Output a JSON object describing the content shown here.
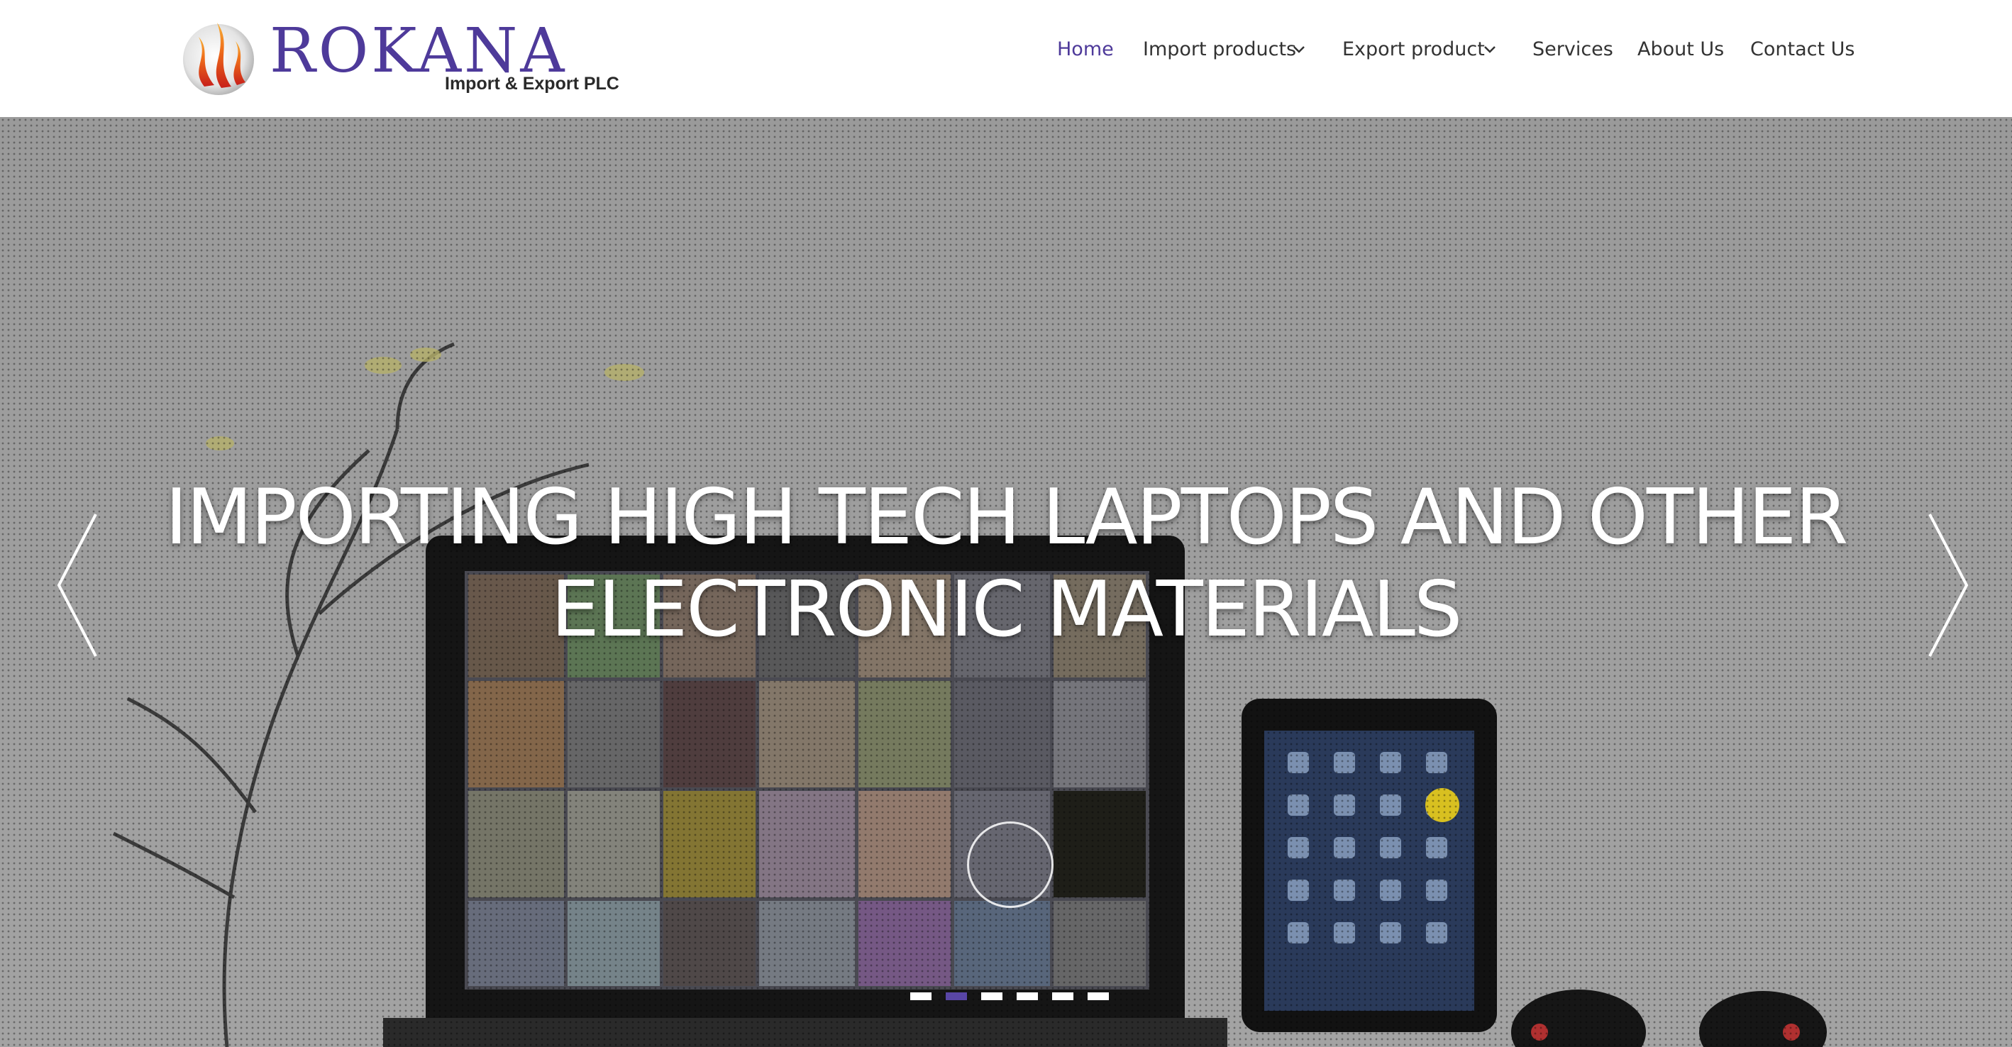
{
  "header": {
    "logo": {
      "wordmark": "ROKANA",
      "tagline": "Import & Export PLC"
    },
    "nav": [
      {
        "label": "Home",
        "active": true,
        "dropdown": false
      },
      {
        "label": "Import products",
        "active": false,
        "dropdown": true
      },
      {
        "label": "Export product",
        "active": false,
        "dropdown": true
      },
      {
        "label": "Services",
        "active": false,
        "dropdown": false
      },
      {
        "label": "About Us",
        "active": false,
        "dropdown": false
      },
      {
        "label": "Contact Us",
        "active": false,
        "dropdown": false
      }
    ]
  },
  "hero": {
    "headline_line1": "IMPORTING HIGH TECH LAPTOPS AND OTHER",
    "headline_line2": "ELECTRONIC MATERIALS",
    "slide_count": 6,
    "active_slide": 2,
    "icons": {
      "prev": "chevron-left-icon",
      "next": "chevron-right-icon",
      "play": "play-icon"
    }
  },
  "colors": {
    "brand": "#4e3a9a",
    "nav_text": "#333333",
    "indicator_active": "#5946a6",
    "indicator": "#ffffff"
  }
}
